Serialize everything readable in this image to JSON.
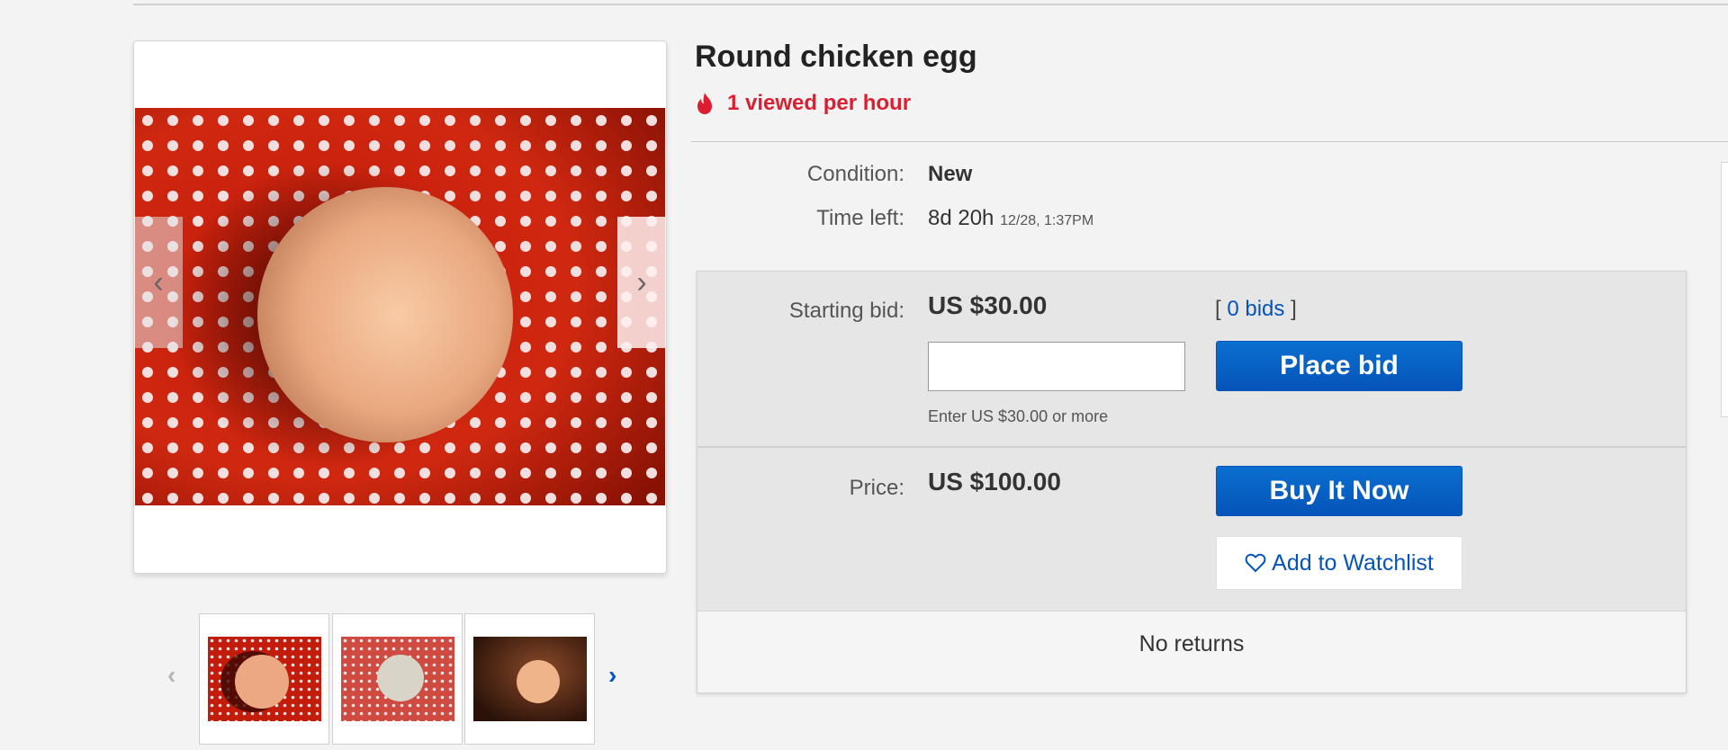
{
  "listing": {
    "title": "Round chicken egg",
    "trend_text": "1 viewed per hour"
  },
  "details": {
    "condition_label": "Condition:",
    "condition_value": "New",
    "time_left_label": "Time left:",
    "time_left_value": "8d 20h",
    "time_left_end": "12/28, 1:37PM"
  },
  "bidding": {
    "starting_bid_label": "Starting bid:",
    "starting_bid_value": "US $30.00",
    "bids_open": "[",
    "bids_count": "0 bids",
    "bids_close": "]",
    "bid_input_value": "",
    "bid_hint": "Enter US $30.00 or more",
    "place_bid_label": "Place bid"
  },
  "buy_now": {
    "price_label": "Price:",
    "price_value": "US $100.00",
    "buy_label": "Buy It Now",
    "watch_label": "Add to Watchlist"
  },
  "returns": {
    "text": "No returns"
  },
  "icons": {
    "trend": "fire-icon",
    "gallery_prev": "chevron-left-icon",
    "gallery_next": "chevron-right-icon",
    "watch": "heart-outline-icon"
  },
  "colors": {
    "accent_blue": "#0654ba",
    "trend_red": "#dd1e31"
  }
}
